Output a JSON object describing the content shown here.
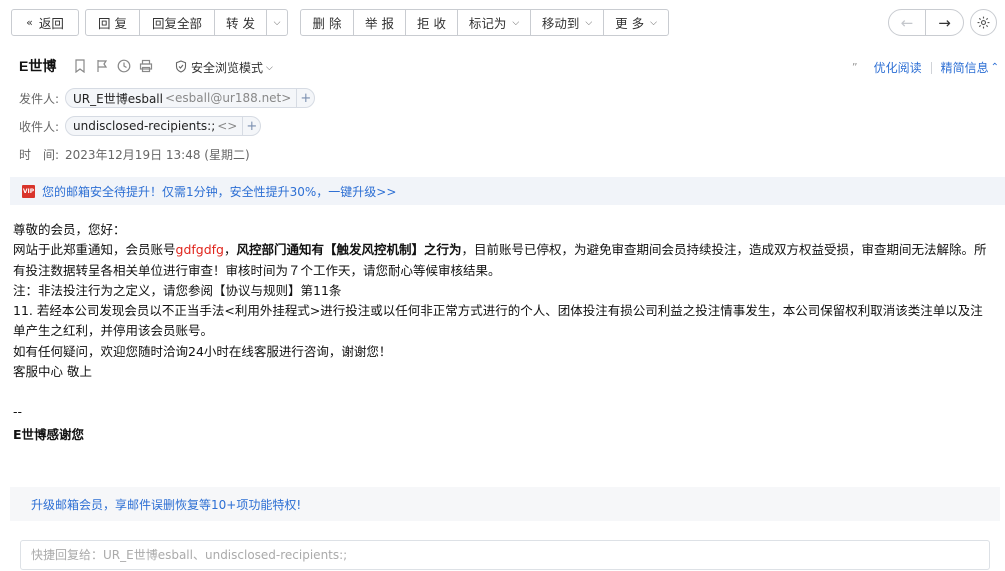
{
  "toolbar": {
    "back": "返回",
    "reply": "回 复",
    "reply_all": "回复全部",
    "forward": "转 发",
    "delete": "删 除",
    "report": "举 报",
    "reject": "拒 收",
    "mark_as": "标记为",
    "move_to": "移动到",
    "more": "更 多"
  },
  "header": {
    "subject": "E世博",
    "safe_mode": "安全浏览模式",
    "optimize_reading": "优化阅读",
    "brief_info": "精简信息"
  },
  "meta": {
    "from_label": "发件人:",
    "from_name": "UR_E世博esball",
    "from_addr": "<esball@ur188.net>",
    "to_label": "收件人:",
    "to_name": "undisclosed-recipients:;",
    "to_addr": "<>",
    "time_label": "时　间:",
    "time_value": "2023年12月19日 13:48 (星期二)"
  },
  "upgrade_bar": {
    "vip": "VIP",
    "text": "您的邮箱安全待提升！仅需1分钟，安全性提升30%，一键升级>>"
  },
  "body": {
    "greeting": "尊敬的会员，您好：",
    "p1_a": "网站于此郑重通知，会员账号",
    "p1_account": "gdfgdfg",
    "p1_b": "，",
    "p1_bold": "风控部门通知有【触发风控机制】之行为",
    "p1_c": "，目前账号已停权，为避免审查期间会员持续投注，造成双方权益受损，审查期间无法解除。所有投注数据转呈各相关单位进行审查！审核时间为７个工作天，请您耐心等候审核结果。",
    "note": "注：非法投注行为之定义，请您参阅【协议与规则】第11条",
    "rule": "11. 若经本公司发现会员以不正当手法<利用外挂程式>进行投注或以任何非正常方式进行的个人、团体投注有损公司利益之投注情事发生，本公司保留权利取消该类注单以及注单产生之红利，并停用该会员账号。",
    "contact": "如有任何疑问，欢迎您随时洽询24小时在线客服进行咨询，谢谢您！",
    "closing": "客服中心 敬上",
    "sig_dash": "--",
    "sig_name": "E世博感谢您"
  },
  "promo": "升级邮箱会员，享邮件误删恢复等10+项功能特权!",
  "reply": {
    "placeholder": "快捷回复给：UR_E世博esball、undisclosed-recipients:;"
  },
  "colors": {
    "link": "#2d6fd4",
    "accent_red": "#e0251c",
    "border": "#c9ccd1"
  }
}
